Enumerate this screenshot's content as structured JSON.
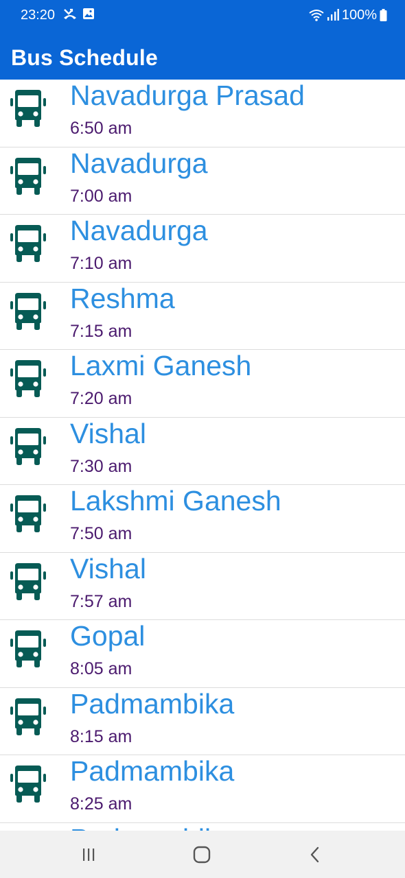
{
  "status_bar": {
    "time": "23:20",
    "battery": "100%"
  },
  "app_bar": {
    "title": "Bus Schedule"
  },
  "colors": {
    "app_bar_bg": "#0a66d6",
    "bus_name": "#2d8fe0",
    "bus_time": "#4b1a6e",
    "bus_icon": "#075b55"
  },
  "buses": [
    {
      "name": "Navadurga Prasad",
      "time": "6:50 am",
      "icon": "bus-icon"
    },
    {
      "name": "Navadurga",
      "time": "7:00 am",
      "icon": "bus-icon"
    },
    {
      "name": "Navadurga",
      "time": "7:10 am",
      "icon": "bus-icon"
    },
    {
      "name": "Reshma",
      "time": "7:15 am",
      "icon": "bus-icon"
    },
    {
      "name": "Laxmi Ganesh",
      "time": "7:20 am",
      "icon": "bus-icon"
    },
    {
      "name": "Vishal",
      "time": "7:30 am",
      "icon": "bus-icon"
    },
    {
      "name": "Lakshmi Ganesh",
      "time": "7:50 am",
      "icon": "bus-icon"
    },
    {
      "name": "Vishal",
      "time": "7:57 am",
      "icon": "bus-icon"
    },
    {
      "name": "Gopal",
      "time": "8:05 am",
      "icon": "bus-icon"
    },
    {
      "name": "Padmambika",
      "time": "8:15 am",
      "icon": "bus-icon"
    },
    {
      "name": "Padmambika",
      "time": "8:25 am",
      "icon": "bus-icon"
    },
    {
      "name": "Padmambika",
      "time": "",
      "icon": "bus-icon"
    }
  ],
  "nav_bar": {
    "buttons": [
      "recents-icon",
      "home-icon",
      "back-icon"
    ]
  }
}
